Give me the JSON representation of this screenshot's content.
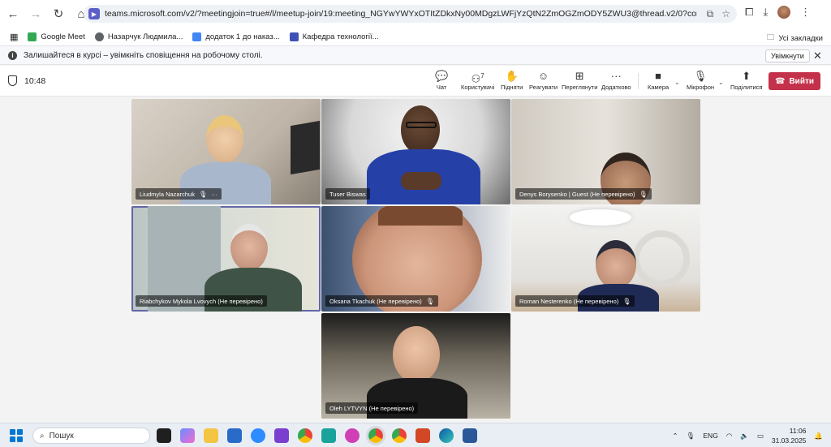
{
  "browser": {
    "url": "teams.microsoft.com/v2/?meetingjoin=true#/l/meetup-join/19:meeting_NGYwYWYxOTItZDkxNy00MDgzLWFjYzQtN2ZmOGZmODY5ZWU3@thread.v2/0?context=%7b\"Tid\"%3...",
    "bookmarks": [
      {
        "label": "Google Meet",
        "color": "#34a853"
      },
      {
        "label": "Назарчук Людмила...",
        "color": "#5f6368"
      },
      {
        "label": "додаток 1 до наказ...",
        "color": "#4285f4"
      },
      {
        "label": "Кафедра технології...",
        "color": "#3f51b5"
      }
    ],
    "all_bookmarks": "Усі закладки",
    "infobar_text": "Залишайтеся в курсі – увімкніть сповіщення на робочому столі.",
    "infobar_button": "Увімкнути"
  },
  "teams": {
    "timer": "10:48",
    "tools": [
      {
        "label": "Чат",
        "icon": "chat-icon",
        "glyph": "💬"
      },
      {
        "label": "Користувачі",
        "icon": "people-icon",
        "glyph": "👥",
        "count": "7"
      },
      {
        "label": "Підняти",
        "icon": "raise-hand-icon",
        "glyph": "✋"
      },
      {
        "label": "Реагувати",
        "icon": "react-icon",
        "glyph": "☺"
      },
      {
        "label": "Переглянути",
        "icon": "view-icon",
        "glyph": "⊞"
      },
      {
        "label": "Додатково",
        "icon": "more-icon",
        "glyph": "···"
      },
      {
        "label": "Камера",
        "icon": "camera-icon",
        "glyph": "■"
      },
      {
        "label": "Мікрофон",
        "icon": "mic-off-icon",
        "glyph": "🎙"
      },
      {
        "label": "Поділитися",
        "icon": "share-icon",
        "glyph": "⬆"
      }
    ],
    "leave_label": "Вийти",
    "accent": "#5b5fc7",
    "leave_color": "#c4314b"
  },
  "participants": [
    {
      "name": "Liudmyla Nazarchuk",
      "muted": true,
      "more": "···"
    },
    {
      "name": "Tuser Biswas",
      "muted": false
    },
    {
      "name": "Denys Borysenko | Guest (Не перевірено)",
      "muted": true
    },
    {
      "name": "Riabchykov Mykola Lvovych (Не перевірено)",
      "muted": false,
      "active": true
    },
    {
      "name": "Oksana Tkachuk (Не перевірено)",
      "muted": true
    },
    {
      "name": "Roman Nesterenko (Не перевірено)",
      "muted": true
    },
    {
      "name": "Oleh LYTVYN (Не перевірено)",
      "muted": false
    }
  ],
  "taskbar": {
    "search_placeholder": "Пошук",
    "language": "ENG",
    "time": "11:06",
    "date": "31.03.2025"
  }
}
